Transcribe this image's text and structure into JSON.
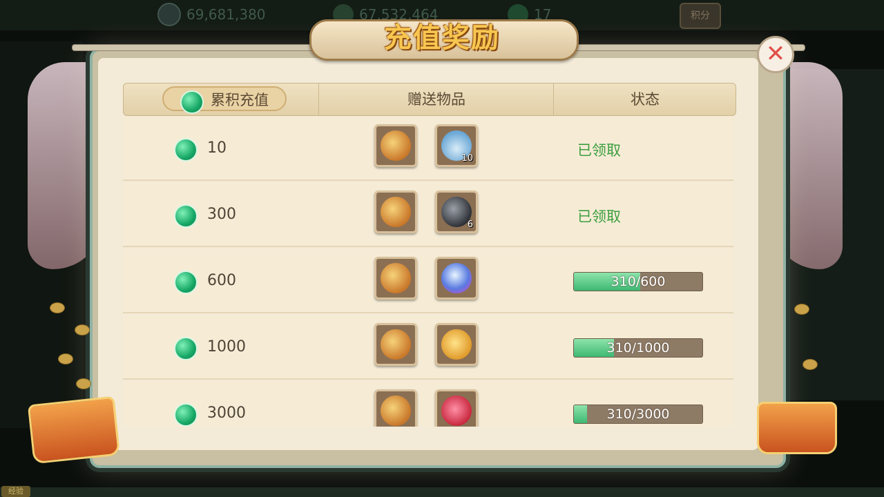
{
  "top_bar": {
    "resource_1_icon": "contribution-icon",
    "resource_1_value": "69,681,380",
    "resource_2_icon": "silver-icon",
    "resource_2_value": "67,532,464",
    "resource_3_icon": "jade-icon",
    "resource_3_value": "17",
    "score_button": "积分"
  },
  "bottom_bar": {
    "exp_tag": "经验"
  },
  "dialog": {
    "title": "充值奖励",
    "close_glyph": "✕"
  },
  "table": {
    "headers": {
      "cumulative": "累积充值",
      "gift_items": "赠送物品",
      "status": "状态"
    },
    "rows": [
      {
        "amount": "10",
        "items": [
          {
            "icon": "money-bag-icon",
            "qty": ""
          },
          {
            "icon": "jade-vase-icon",
            "qty": "10"
          }
        ],
        "status": "已领取",
        "progress": null
      },
      {
        "amount": "300",
        "items": [
          {
            "icon": "money-bag-icon",
            "qty": ""
          },
          {
            "icon": "dark-ore-icon",
            "qty": "6"
          }
        ],
        "status": "已领取",
        "progress": null
      },
      {
        "amount": "600",
        "items": [
          {
            "icon": "money-bag-icon",
            "qty": ""
          },
          {
            "icon": "crystal-orb-icon",
            "qty": ""
          }
        ],
        "status": "",
        "progress": {
          "current": 310,
          "target": 600,
          "label": "310/600"
        }
      },
      {
        "amount": "1000",
        "items": [
          {
            "icon": "money-bag-icon",
            "qty": ""
          },
          {
            "icon": "gold-pouch-icon",
            "qty": ""
          }
        ],
        "status": "",
        "progress": {
          "current": 310,
          "target": 1000,
          "label": "310/1000"
        }
      },
      {
        "amount": "3000",
        "items": [
          {
            "icon": "money-bag-icon",
            "qty": ""
          },
          {
            "icon": "red-pouch-icon",
            "qty": ""
          }
        ],
        "status": "",
        "progress": {
          "current": 310,
          "target": 3000,
          "label": "310/3000"
        }
      }
    ]
  },
  "colors": {
    "claimed_text": "#3b9e3e",
    "progress_fill": "#3eb873",
    "title_gold": "#f7c650"
  }
}
